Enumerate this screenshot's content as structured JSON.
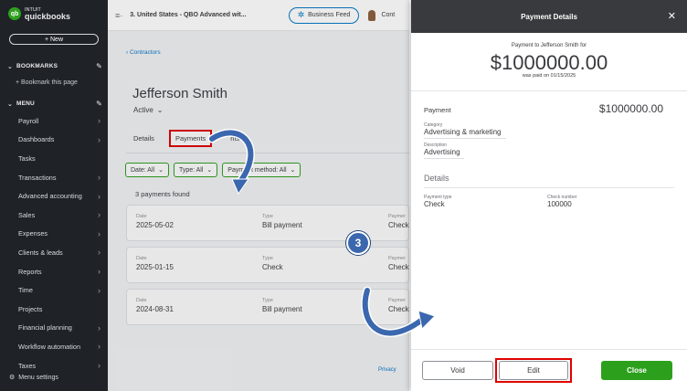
{
  "sidebar": {
    "logo_small": "INTUIT",
    "logo_big": "quickbooks",
    "new_label": "+ New",
    "bookmarks_label": "BOOKMARKS",
    "bookmark_page": "+ Bookmark this page",
    "menu_label": "MENU",
    "items": [
      {
        "label": "Payroll"
      },
      {
        "label": "Dashboards"
      },
      {
        "label": "Tasks"
      },
      {
        "label": "Transactions"
      },
      {
        "label": "Advanced accounting"
      },
      {
        "label": "Sales"
      },
      {
        "label": "Expenses"
      },
      {
        "label": "Clients & leads"
      },
      {
        "label": "Reports"
      },
      {
        "label": "Time"
      },
      {
        "label": "Projects"
      },
      {
        "label": "Financial planning"
      },
      {
        "label": "Workflow automation"
      },
      {
        "label": "Taxes"
      }
    ],
    "settings_label": "Menu settings"
  },
  "topbar": {
    "company": "3. United States - QBO Advanced wit...",
    "business_feed": "Business Feed",
    "cont": "Cont"
  },
  "main": {
    "breadcrumb": "‹ Contractors",
    "vendor_name": "Jefferson Smith",
    "status": "Active",
    "tabs": {
      "details": "Details",
      "payments": "Payments",
      "attachments": "nts"
    },
    "filters": {
      "date": "Date: All",
      "type": "Type: All",
      "method": "Payment method: All"
    },
    "found": "3 payments found",
    "col_labels": {
      "date": "Date",
      "type": "Type",
      "method": "Paymer"
    },
    "payments": [
      {
        "date": "2025-05-02",
        "type": "Bill payment",
        "method": "Check"
      },
      {
        "date": "2025-01-15",
        "type": "Check",
        "method": "Check"
      },
      {
        "date": "2024-08-31",
        "type": "Bill payment",
        "method": "Check"
      }
    ],
    "privacy": "Privacy"
  },
  "drawer": {
    "title": "Payment Details",
    "payment_to": "Payment to Jefferson Smith for",
    "amount": "$1000000.00",
    "paid_on": "was paid on 01/15/2025",
    "payment_label": "Payment",
    "payment_amount": "$1000000.00",
    "category_label": "Category",
    "category_value": "Advertising & marketing",
    "description_label": "Description",
    "description_value": "Advertising",
    "details_label": "Details",
    "payment_type_label": "Payment type",
    "payment_type_value": "Check",
    "check_number_label": "Check number",
    "check_number_value": "100000",
    "void_label": "Void",
    "edit_label": "Edit",
    "close_label": "Close"
  },
  "annotation": {
    "step": "3"
  },
  "colors": {
    "accent_green": "#2ca01c",
    "link_blue": "#0077c5",
    "sidebar_bg": "#1f2328",
    "highlight_red": "#e00000",
    "step_blue": "#3b67ae"
  }
}
